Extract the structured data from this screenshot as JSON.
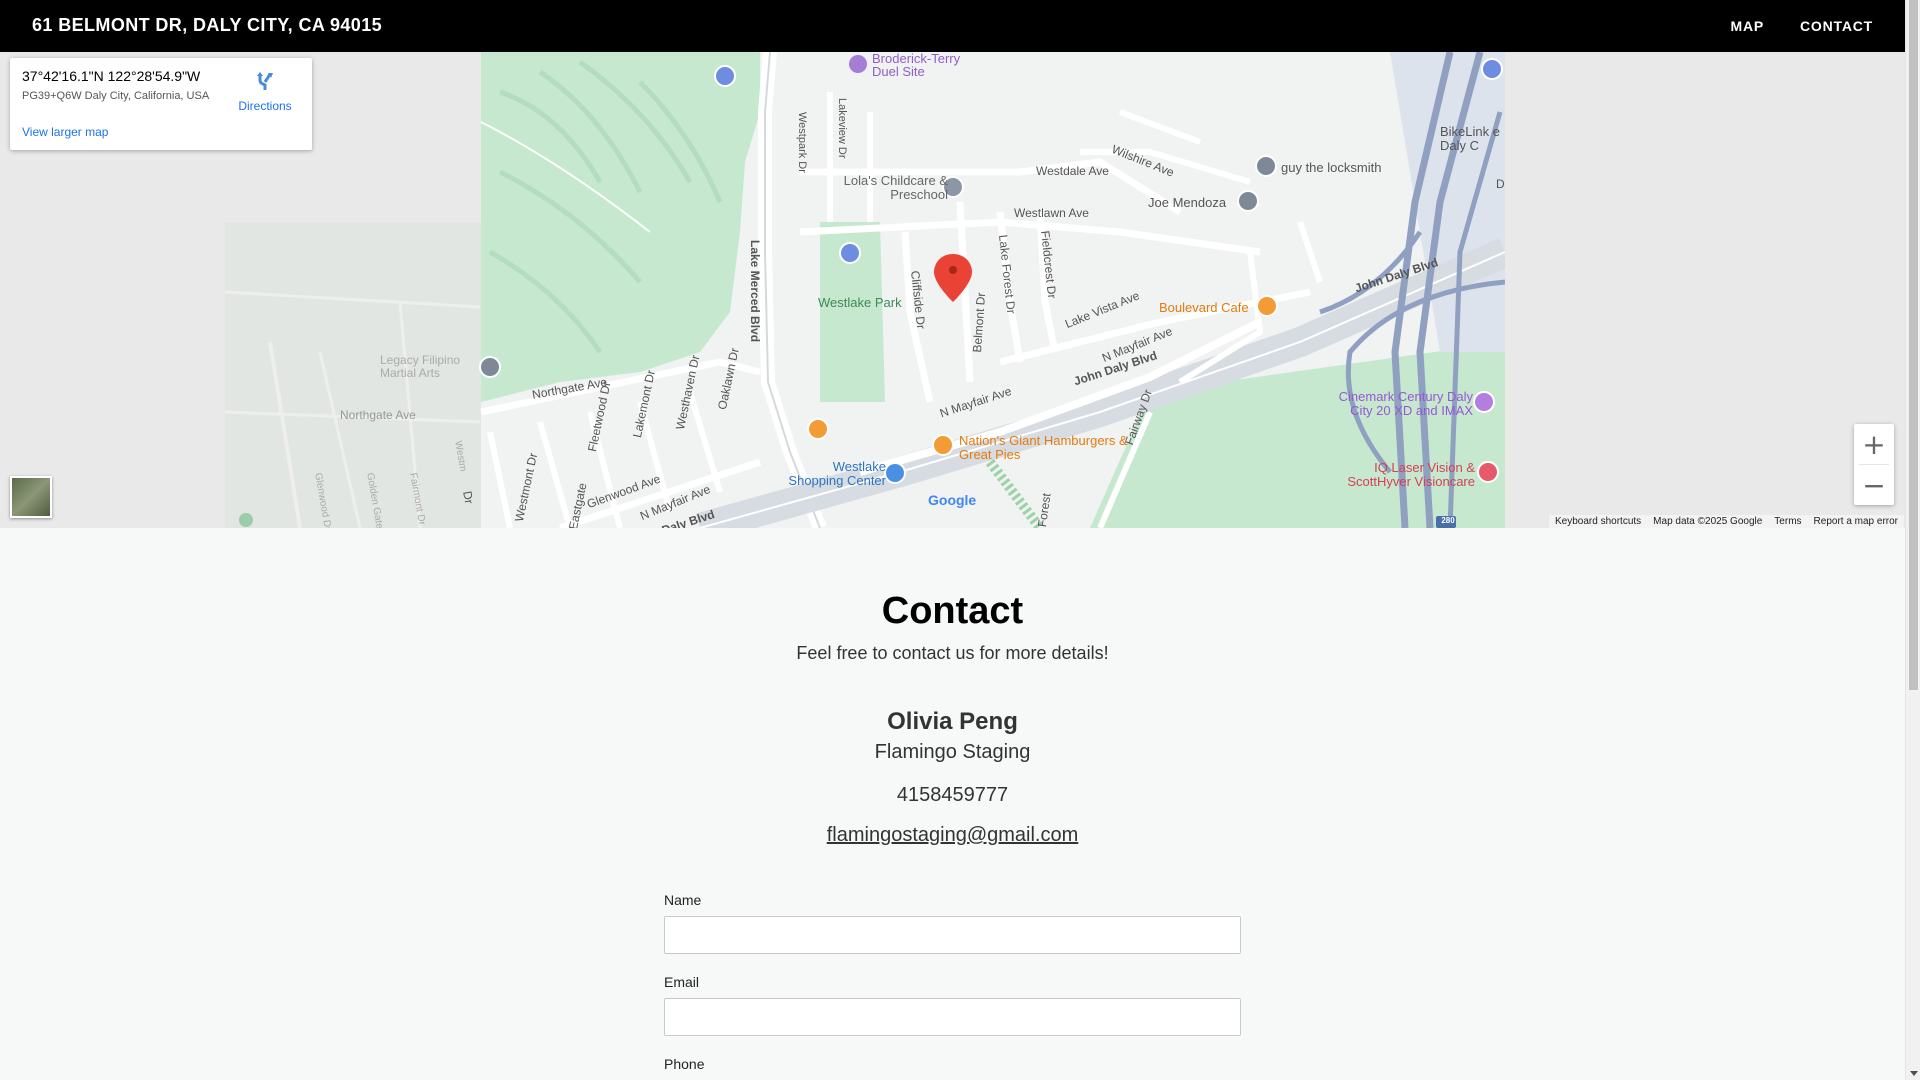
{
  "header": {
    "title": "61 BELMONT DR, DALY CITY, CA 94015",
    "nav": [
      "MAP",
      "CONTACT"
    ]
  },
  "map": {
    "info_card": {
      "coords": "37°42'16.1\"N 122°28'54.9\"W",
      "plus_code": "PG39+Q6W Daly City, California, USA",
      "directions_label": "Directions",
      "larger_map_link": "View larger map"
    },
    "places": {
      "broderick": "Broderick-Terry Duel Site",
      "lolas": "Lola's Childcare & Preschool",
      "westlake_park": "Westlake Park",
      "guy_locksmith": "guy the locksmith",
      "joe_mendoza": "Joe Mendoza",
      "boulevard_cafe": "Boulevard Cafe",
      "nations_giant": "Nation's Giant Hamburgers & Great Pies",
      "westlake_shopping": "Westlake Shopping Center",
      "cinemark": "Cinemark Century Daly City 20 XD and IMAX",
      "iq_laser": "IQ Laser Vision & ScottHyver Visioncare",
      "bikelink": "BikeLink e Daly C",
      "legacy": "Legacy Filipino Martial Arts"
    },
    "streets": {
      "lake_merced": "Lake Merced Blvd",
      "westpark": "Westpark Dr",
      "lakeview": "Lakeview Dr",
      "wilshire": "Wilshire Ave",
      "westdale": "Westdale Ave",
      "westlawn": "Westlawn Ave",
      "cliffside": "Cliffside Dr",
      "lake_forest": "Lake Forest Dr",
      "fieldcrest": "Fieldcrest Dr",
      "belmont": "Belmont Dr",
      "lake_vista": "Lake Vista Ave",
      "john_daly_1": "John Daly Blvd",
      "john_daly_2": "John Daly Blvd",
      "john_daly_3": "Daly Blvd",
      "n_mayfair_1": "N Mayfair Ave",
      "n_mayfair_2": "N Mayfair Ave",
      "n_mayfair_3": "N Mayfair Ave",
      "northgate": "Northgate Ave",
      "northgate_2": "Northgate Ave",
      "fleetwood": "Fleetwood Dr",
      "lakemont": "Lakemont Dr",
      "westhaven": "Westhaven Dr",
      "oaklawn": "Oaklawn Dr",
      "westmont": "Westmont Dr",
      "glenwood": "Glenwood Ave",
      "eastgate": "Eastgate",
      "fairway": "Fairway Dr",
      "forest": "Forest",
      "d_label": "D",
      "glenwood_dr": "Glenwood Dr",
      "golden_gate": "Golden Gate Dr",
      "westm": "Westm",
      "fairmont": "Fairmont Dr",
      "dr": "Dr"
    },
    "google_logo": "Google",
    "highway_shield": "280",
    "attribution": {
      "shortcuts": "Keyboard shortcuts",
      "data": "Map data ©2025 Google",
      "terms": "Terms",
      "report": "Report a map error"
    },
    "zoom_in": "+",
    "zoom_out": "−"
  },
  "contact": {
    "title": "Contact",
    "subtitle": "Feel free to contact us for more details!",
    "name": "Olivia Peng",
    "company": "Flamingo Staging",
    "phone": "4158459777",
    "email": "flamingostaging@gmail.com",
    "form": {
      "name_label": "Name",
      "email_label": "Email",
      "phone_label": "Phone"
    }
  },
  "colors": {
    "header_bg": "#000000",
    "park_green": "#c5e8cf",
    "road": "#ffffff",
    "highway": "#9aa7c2",
    "link_blue": "#1a73e8",
    "pin_red": "#ea4335",
    "food_orange": "#f39c36"
  }
}
